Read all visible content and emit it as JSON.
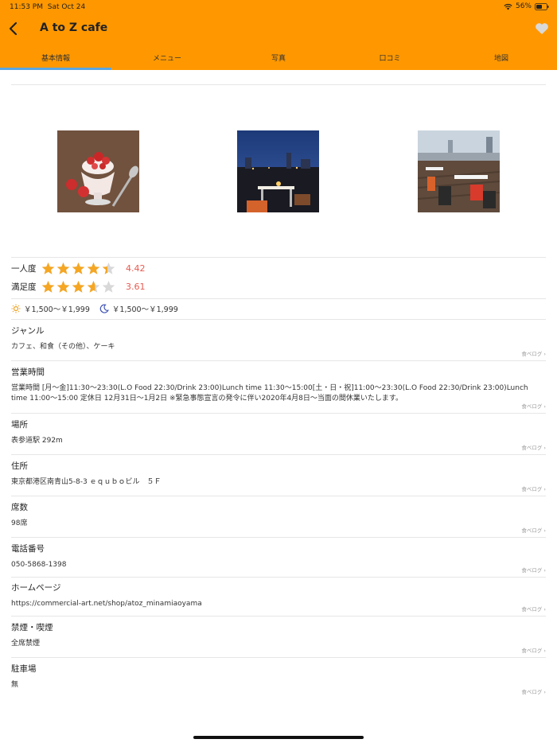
{
  "status_bar": {
    "time": "11:53 PM",
    "date": "Sat Oct 24",
    "battery": "56%"
  },
  "nav": {
    "title": "A to Z cafe"
  },
  "tabs": [
    {
      "label": "基本情報",
      "active": true
    },
    {
      "label": "メニュー"
    },
    {
      "label": "写真"
    },
    {
      "label": "口コミ"
    },
    {
      "label": "地図"
    }
  ],
  "ratings": [
    {
      "label": "一人度",
      "value": "4.42",
      "stars": 4.42
    },
    {
      "label": "満足度",
      "value": "3.61",
      "stars": 3.61
    }
  ],
  "prices": {
    "lunch": "￥1,500～￥1,999",
    "dinner": "￥1,500～￥1,999"
  },
  "source_label": "食べログ ›",
  "sections": [
    {
      "title": "ジャンル",
      "value": "カフェ、和食（その他）、ケーキ"
    },
    {
      "title": "営業時間",
      "value": "営業時間 [月～金]11:30～23:30(L.O Food 22:30/Drink 23:00)Lunch time 11:30～15:00[土・日・祝]11:00～23:30(L.O Food 22:30/Drink 23:00)Lunch time 11:00～15:00 定休日 12月31日～1月2日 ※緊急事態宣言の発令に伴い2020年4月8日～当面の間休業いたします。"
    },
    {
      "title": "場所",
      "value": "表参道駅 292m"
    },
    {
      "title": "住所",
      "value": "東京都港区南青山5-8-3 ｅｑｕｂｏビル　５Ｆ"
    },
    {
      "title": "席数",
      "value": "98席"
    },
    {
      "title": "電話番号",
      "value": "050-5868-1398"
    },
    {
      "title": "ホームページ",
      "value": "https://commercial-art.net/shop/atoz_minamiaoyama"
    },
    {
      "title": "禁煙・喫煙",
      "value": "全席禁煙"
    },
    {
      "title": "駐車場",
      "value": "無"
    }
  ],
  "colors": {
    "header": "#ff9800",
    "rating": "#e85a4f",
    "star": "#f5a623",
    "tab_indicator": "#5aa6e0"
  }
}
